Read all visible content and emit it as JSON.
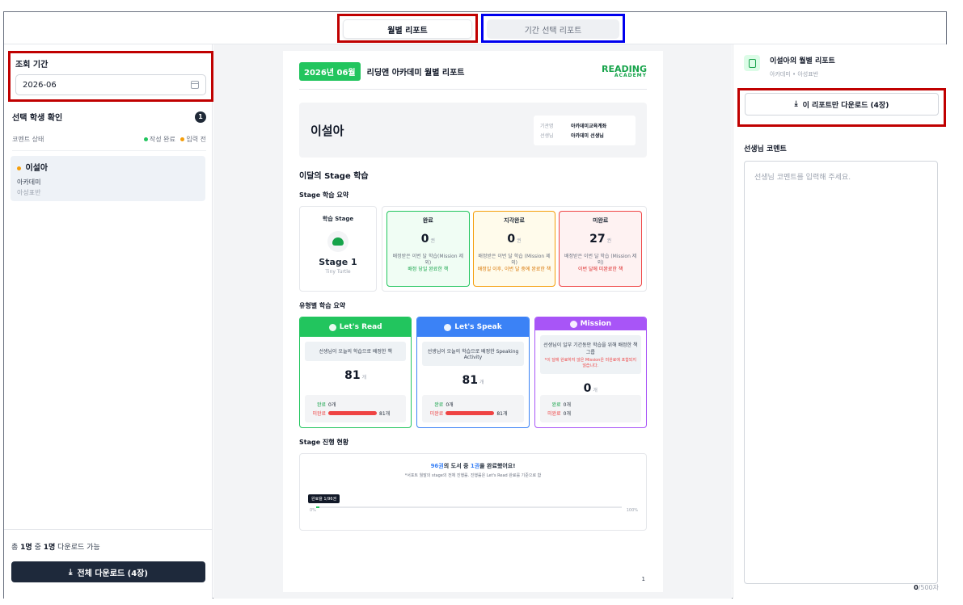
{
  "tabs": {
    "monthly": "월별 리포트",
    "period": "기간 선택 리포트"
  },
  "sidebar": {
    "period_label": "조회 기간",
    "period_value": "2026-06",
    "selected_label": "선택 학생 확인",
    "selected_count": "1",
    "comment_status_label": "코멘트 상태",
    "legend_done": "작성 완료",
    "legend_pending": "입력 전",
    "student": {
      "name": "이설아",
      "academy": "아카데미",
      "class": "아성표반"
    },
    "available_prefix": "총",
    "available_total": "1명",
    "available_mid": "중",
    "available_count": "1명",
    "available_suffix": "다운로드 가능",
    "download_all": "전체 다운로드 (4장)"
  },
  "report": {
    "month_badge": "2026년 06월",
    "title": "리딩앤 아카데미 월별 리포트",
    "logo_main": "READING",
    "logo_sub": "ACADEMY",
    "student_name": "이설아",
    "org_label": "기관명",
    "org_value": "아카데미교육계좌",
    "teacher_label": "선생님",
    "teacher_value": "아카데미 선생님",
    "section_stage": "이달의 Stage 학습",
    "sub_stage_summary": "Stage 학습 요약",
    "stage_card_title": "학습 Stage",
    "stage_name": "Stage 1",
    "stage_sub": "Tiny Turtle",
    "status": [
      {
        "title": "완료",
        "value": "0",
        "unit": "권",
        "desc": "배정받은 이번 달 학습(Mission 제외)",
        "desc2": "배정 당일 완료한 책"
      },
      {
        "title": "지각완료",
        "value": "0",
        "unit": "권",
        "desc": "배정받은 이번 달 학습 (Mission 제외)",
        "desc2": "배정일 이후, 이번 달 중에 완료한 책"
      },
      {
        "title": "미완료",
        "value": "27",
        "unit": "권",
        "desc": "배정받은 이번 달 학습 (Mission 제외)",
        "desc2": "이번 달에 미완료한 책"
      }
    ],
    "sub_type_summary": "유형별 학습 요약",
    "types": [
      {
        "title": "Let's Read",
        "desc": "선생님이 오늘의 학습으로 배정한 책",
        "warn": "",
        "value": "81",
        "unit": "개",
        "done_label": "완료",
        "done_value": "0개",
        "undone_label": "미완료",
        "undone_value": "81개",
        "undone_ratio": 1.0
      },
      {
        "title": "Let's Speak",
        "desc": "선생님이 오늘의 학습으로 배정한 Speaking Activity",
        "warn": "",
        "value": "81",
        "unit": "개",
        "done_label": "완료",
        "done_value": "0개",
        "undone_label": "미완료",
        "undone_value": "81개",
        "undone_ratio": 1.0
      },
      {
        "title": "Mission",
        "desc": "선생님이 일부 기간동안 학습을 위해 배정한 책 그룹",
        "warn": "*이 달에 완료하지 않은 Mission은 미완료에 포함되지 않습니다.",
        "value": "0",
        "unit": "개",
        "done_label": "완료",
        "done_value": "0개",
        "undone_label": "미완료",
        "undone_value": "0개",
        "undone_ratio": 0
      }
    ],
    "sub_progress": "Stage 진행 현황",
    "progress_total": "96권",
    "progress_mid": "의 도서 중",
    "progress_done": "1권",
    "progress_end": "을 완료했어요!",
    "progress_note": "*서포트 월말의 stage의 전체 진행률. 진행률은 Let's Read 완료를 기준으로 함",
    "progress_tip": "완료율 1/96권",
    "progress_ratio": 0.0104,
    "progress_min": "0%",
    "progress_max": "100%",
    "page_number": "1"
  },
  "right": {
    "title": "이설아의 월별 리포트",
    "sub": "아카데미 • 아성표반",
    "download_one": "이 리포트만 다운로드 (4장)",
    "comment_label": "선생님 코멘트",
    "comment_placeholder": "선생님 코멘트를 입력해 주세요.",
    "counter_value": "0",
    "counter_max": "/500자"
  },
  "colors": {
    "done": "#22c55e",
    "late": "#f59e0b",
    "undone": "#ef4444",
    "speak": "#3b82f6",
    "mission": "#a855f7",
    "highlight_red": "#c00000",
    "highlight_blue": "#0000ee"
  }
}
